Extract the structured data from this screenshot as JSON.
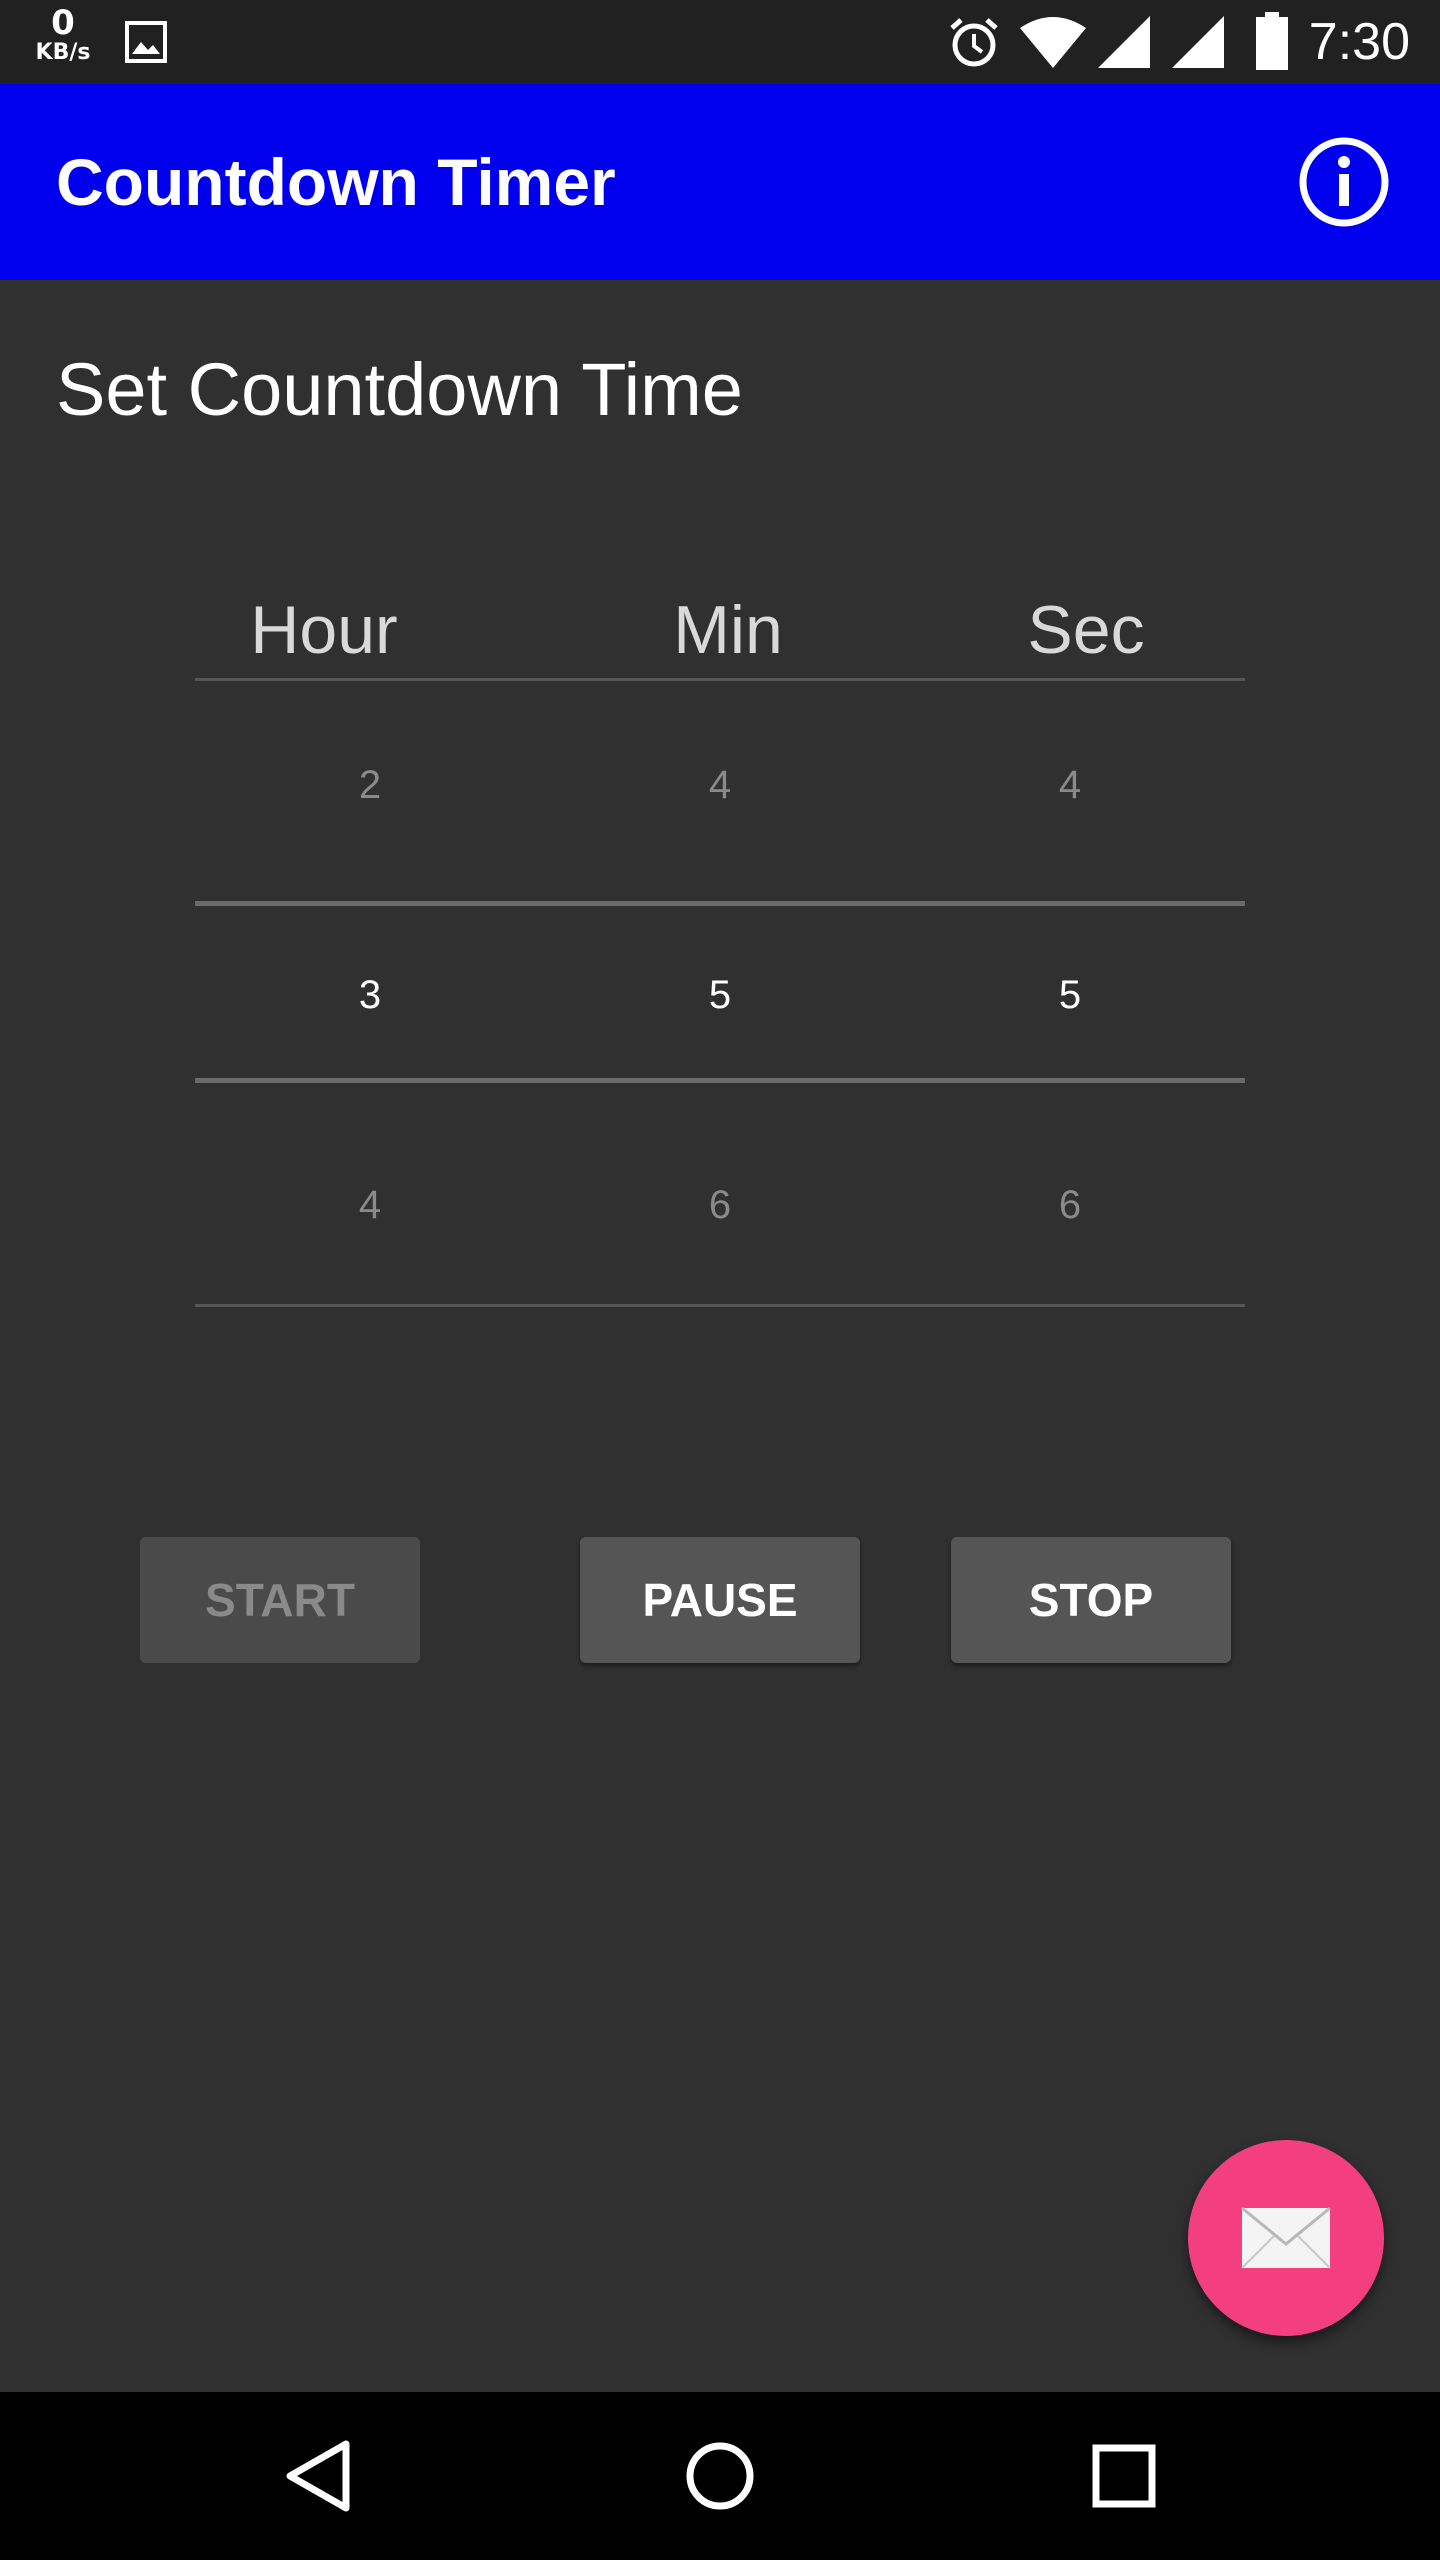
{
  "status_bar": {
    "net_speed_value": "0",
    "net_speed_unit": "KB/s",
    "time": "7:30",
    "icons": [
      "image-notification-icon",
      "alarm-icon",
      "wifi-icon",
      "signal-icon",
      "signal-icon",
      "battery-icon"
    ]
  },
  "app_bar": {
    "title": "Countdown Timer",
    "info_icon": "info-icon",
    "background_color": "#0000ee"
  },
  "section_title": "Set Countdown Time",
  "picker": {
    "headers": {
      "hour": "Hour",
      "min": "Min",
      "sec": "Sec"
    },
    "hour": {
      "above": "2",
      "selected": "3",
      "below": "4"
    },
    "min": {
      "above": "4",
      "selected": "5",
      "below": "6"
    },
    "sec": {
      "above": "4",
      "selected": "5",
      "below": "6"
    }
  },
  "buttons": {
    "start": "START",
    "pause": "PAUSE",
    "stop": "STOP",
    "start_enabled": false
  },
  "fab": {
    "icon": "envelope-icon",
    "color": "#f43f7f"
  },
  "nav_bar": {
    "icons": [
      "back-icon",
      "home-icon",
      "recents-icon"
    ]
  }
}
